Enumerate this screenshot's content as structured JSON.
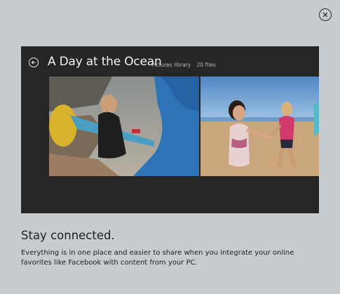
{
  "dialog": {
    "close_icon": "close-circle-icon"
  },
  "preview": {
    "back_icon": "back-arrow-circle-icon",
    "album_title": "A Day at the Ocean",
    "library_label": "Pictures library",
    "file_count": "20 files",
    "photos": [
      {
        "description_icon": "photo-surfer-on-beach"
      },
      {
        "description_icon": "photo-friends-on-beach"
      }
    ]
  },
  "content": {
    "headline": "Stay connected.",
    "body_line1": "Everything is in one place and easier to share when you integrate your online",
    "body_line2": "favorites like Facebook with content from your PC."
  }
}
